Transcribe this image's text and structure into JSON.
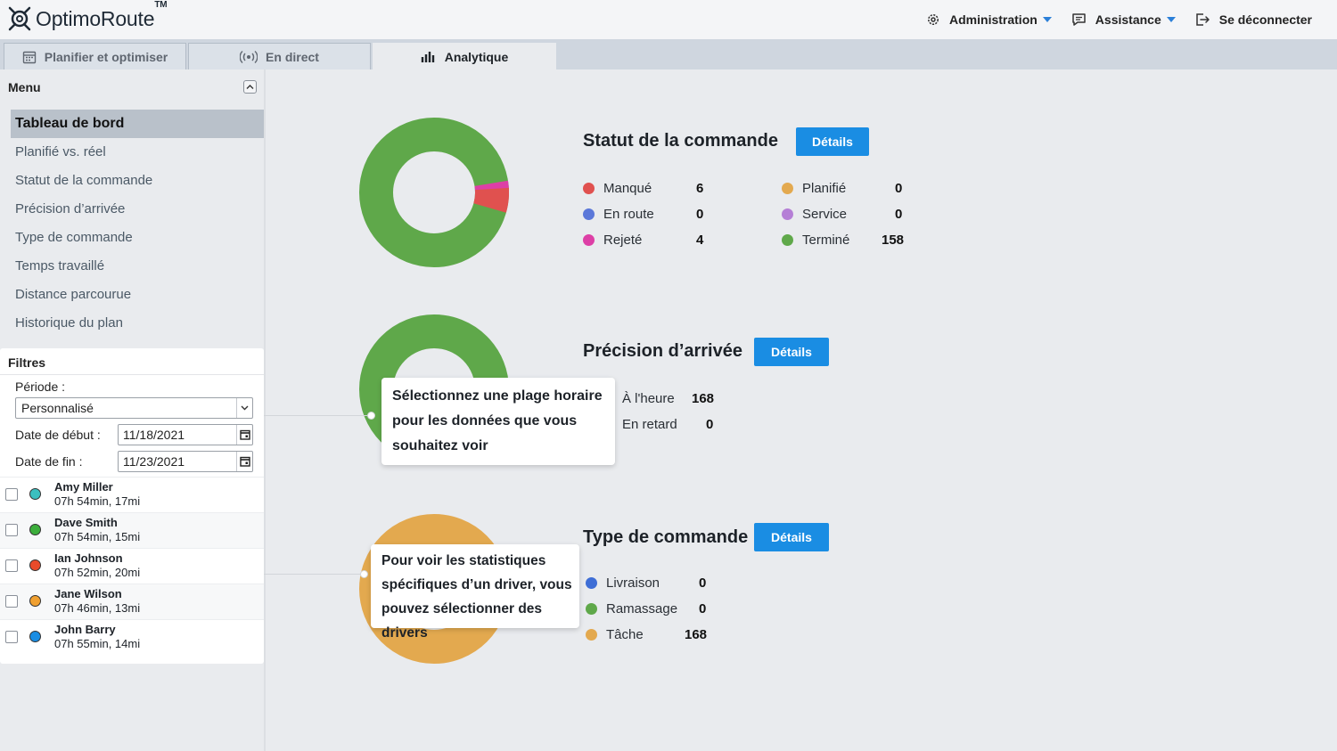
{
  "app": {
    "name": "OptimoRoute",
    "tm": "TM"
  },
  "topnav": {
    "admin": "Administration",
    "support": "Assistance",
    "logout": "Se déconnecter"
  },
  "tabs": [
    {
      "label": "Planifier et optimiser"
    },
    {
      "label": "En direct"
    },
    {
      "label": "Analytique"
    }
  ],
  "sidebar": {
    "menu_title": "Menu",
    "items": [
      {
        "label": "Tableau de bord"
      },
      {
        "label": "Planifié vs. réel"
      },
      {
        "label": "Statut de la commande"
      },
      {
        "label": "Précision d’arrivée"
      },
      {
        "label": "Type de commande"
      },
      {
        "label": "Temps travaillé"
      },
      {
        "label": "Distance parcourue"
      },
      {
        "label": "Historique du plan"
      }
    ]
  },
  "filters": {
    "title": "Filtres",
    "period_label": "Période :",
    "period_value": "Personnalisé",
    "start_label": "Date de début :",
    "start_value": "11/18/2021",
    "end_label": "Date de fin :",
    "end_value": "11/23/2021",
    "drivers": [
      {
        "name": "Amy Miller",
        "meta": "07h 54min, 17mi",
        "color": "#3bbfbf"
      },
      {
        "name": "Dave Smith",
        "meta": "07h 54min, 15mi",
        "color": "#3cae3c"
      },
      {
        "name": "Ian Johnson",
        "meta": "07h 52min, 20mi",
        "color": "#ea4b2a"
      },
      {
        "name": "Jane Wilson",
        "meta": "07h 46min, 13mi",
        "color": "#f0a030"
      },
      {
        "name": "John Barry",
        "meta": "07h 55min, 14mi",
        "color": "#1a8de3"
      }
    ]
  },
  "order_status": {
    "title": "Statut de la commande",
    "details": "Détails",
    "items": [
      {
        "label": "Manqué",
        "value": "6",
        "color": "#e0514f"
      },
      {
        "label": "En route",
        "value": "0",
        "color": "#5b78d9"
      },
      {
        "label": "Rejeté",
        "value": "4",
        "color": "#dd3fa6"
      },
      {
        "label": "Planifié",
        "value": "0",
        "color": "#e3a94f"
      },
      {
        "label": "Service",
        "value": "0",
        "color": "#b57fd6"
      },
      {
        "label": "Terminé",
        "value": "158",
        "color": "#5fa84a"
      }
    ]
  },
  "arrival": {
    "title": "Précision d’arrivée",
    "details": "Détails",
    "items": [
      {
        "label": "À l'heure",
        "value": "168"
      },
      {
        "label": "En retard",
        "value": "0"
      }
    ],
    "color": "#5fa84a"
  },
  "order_type": {
    "title": "Type de commande",
    "details": "Détails",
    "items": [
      {
        "label": "Livraison",
        "value": "0",
        "color": "#3e6ed6"
      },
      {
        "label": "Ramassage",
        "value": "0",
        "color": "#5fa84a"
      },
      {
        "label": "Tâche",
        "value": "168",
        "color": "#e3a94f"
      }
    ]
  },
  "callouts": {
    "period": "Sélectionnez une plage horaire pour les données que vous souhaitez voir",
    "drivers": "Pour voir les statistiques spécifiques d’un driver, vous pouvez sélectionner des drivers"
  }
}
